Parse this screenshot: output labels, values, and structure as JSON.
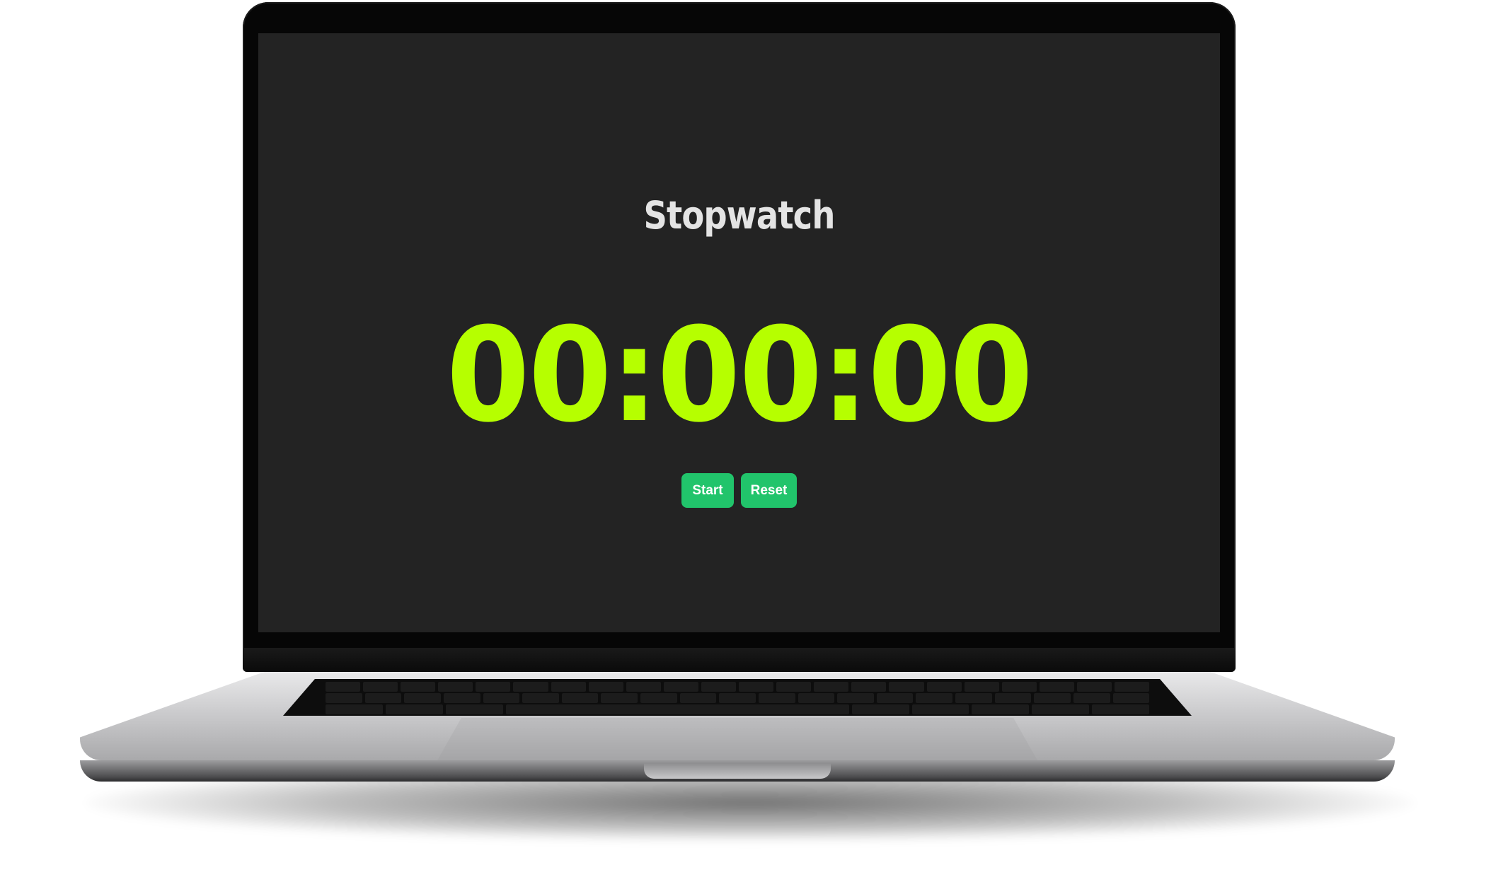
{
  "app": {
    "title": "Stopwatch",
    "time_display": "00:00:00"
  },
  "controls": {
    "start_label": "Start",
    "reset_label": "Reset"
  },
  "colors": {
    "screen_background": "#232323",
    "title_text": "#e4e4e4",
    "time_text": "#b6ff00",
    "button_background": "#21c46b",
    "button_text": "#ffffff"
  }
}
